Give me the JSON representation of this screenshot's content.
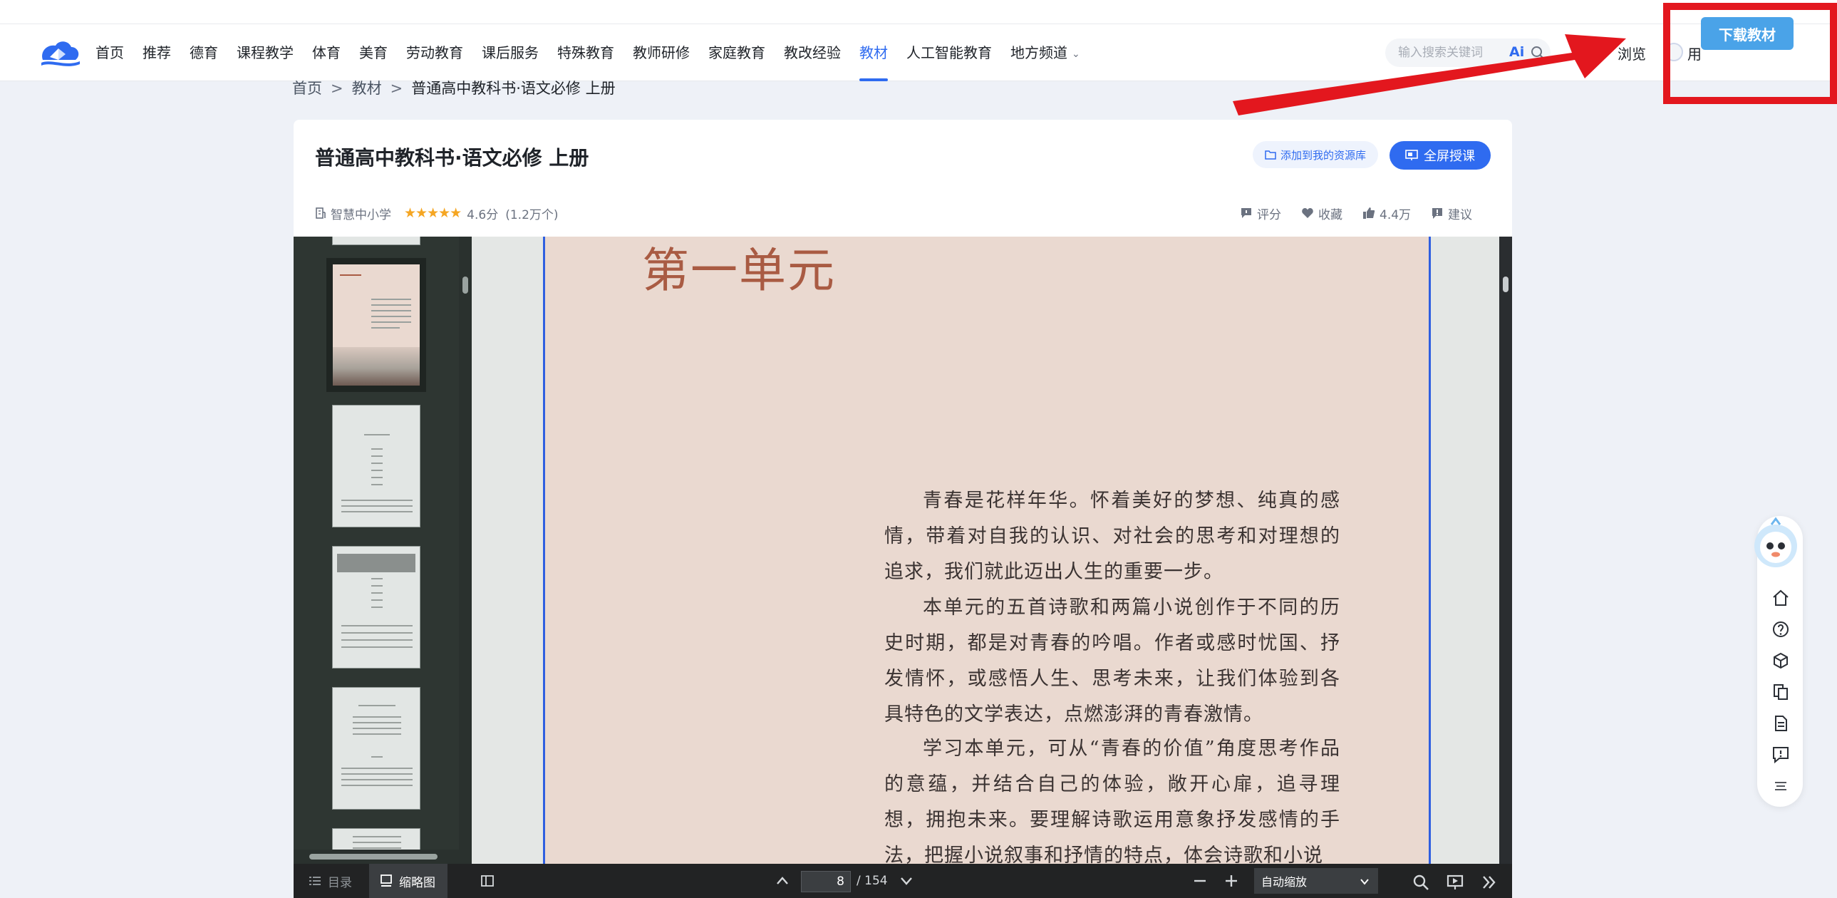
{
  "header": {
    "nav": [
      {
        "label": "首页"
      },
      {
        "label": "推荐"
      },
      {
        "label": "德育"
      },
      {
        "label": "课程教学"
      },
      {
        "label": "体育"
      },
      {
        "label": "美育"
      },
      {
        "label": "劳动教育"
      },
      {
        "label": "课后服务"
      },
      {
        "label": "特殊教育"
      },
      {
        "label": "教师研修"
      },
      {
        "label": "家庭教育"
      },
      {
        "label": "教改经验"
      },
      {
        "label": "教材",
        "active": true
      },
      {
        "label": "人工智能教育"
      },
      {
        "label": "地方频道"
      }
    ],
    "search_placeholder": "输入搜索关键词",
    "ai_label": "Ai",
    "browse_label": "浏览",
    "user_label": "用",
    "download_label": "下载教材"
  },
  "breadcrumb": {
    "home": "首页",
    "section": "教材",
    "current": "普通高中教科书·语文必修 上册",
    "sep": ">"
  },
  "book": {
    "title": "普通高中教科书·语文必修 上册",
    "add_label": "添加到我的资源库",
    "fullscreen_label": "全屏授课",
    "source": "智慧中小学",
    "rating": 4.6,
    "rating_text": "4.6分",
    "rating_count": "(1.2万个)",
    "actions": {
      "rate": "评分",
      "favorite": "收藏",
      "likes": "4.4万",
      "suggest": "建议"
    }
  },
  "viewer": {
    "unit_title": "第一单元",
    "paragraphs": [
      "青春是花样年华。怀着美好的梦想、纯真的感情，带着对自我的认识、对社会的思考和对理想的追求，我们就此迈出人生的重要一步。",
      "本单元的五首诗歌和两篇小说创作于不同的历史时期，都是对青春的吟唱。作者或感时忧国、抒发情怀，或感悟人生、思考未来，让我们体验到各具特色的文学表达，点燃澎湃的青春激情。",
      "学习本单元，可从“青春的价值”角度思考作品的意蕴，并结合自己的体验，敞开心扉，追寻理想，拥抱未来。要理解诗歌运用意象抒发感情的手法，把握小说叙事和抒情的特点，体会诗歌和小说"
    ],
    "toolbar": {
      "toc_label": "目录",
      "thumbs_label": "缩略图",
      "page_current": "8",
      "page_total": "/ 154",
      "zoom_label": "自动缩放"
    }
  },
  "colors": {
    "accent": "#2f6bf0",
    "download": "#4aa3e8",
    "highlight": "#e3171e",
    "unit_title": "#a95b43",
    "page_bg": "#ead9d0"
  }
}
